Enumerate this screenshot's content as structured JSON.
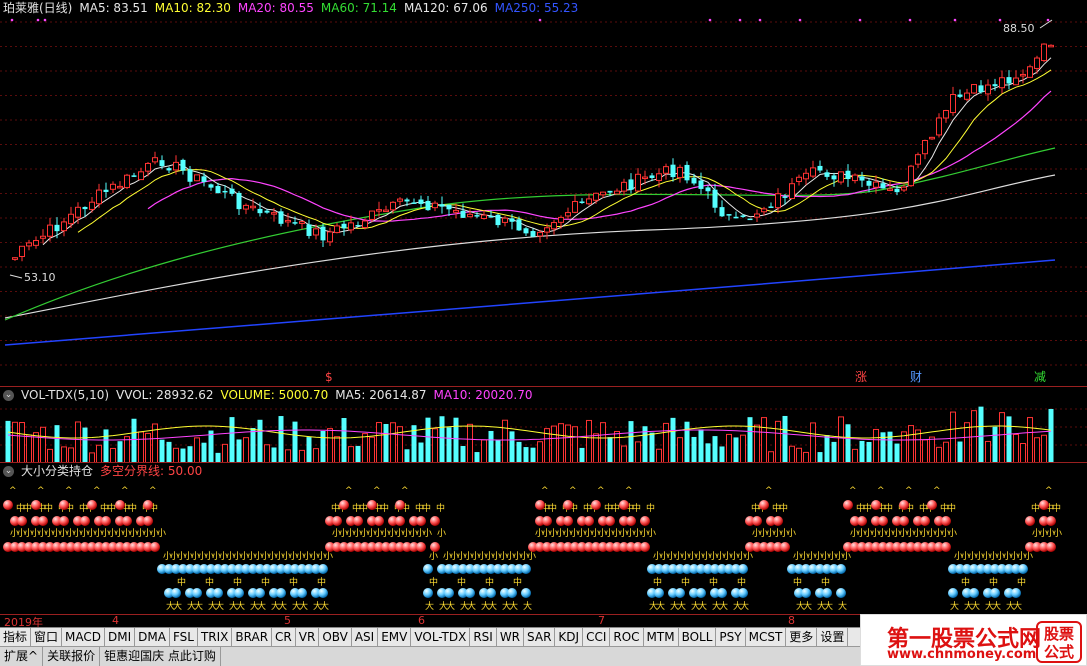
{
  "price_panel": {
    "title": "珀莱雅(日线)",
    "ma": [
      {
        "label": "MA5: 83.51",
        "color": "#e6e6e6"
      },
      {
        "label": "MA10: 82.30",
        "color": "#ffff33"
      },
      {
        "label": "MA20: 80.55",
        "color": "#ff44ff"
      },
      {
        "label": "MA60: 71.14",
        "color": "#33dd33"
      },
      {
        "label": "MA120: 67.06",
        "color": "#e6e6e6"
      },
      {
        "label": "MA250: 55.23",
        "color": "#3355ff"
      }
    ],
    "high_label": "88.50",
    "low_label": "53.10",
    "events": [
      {
        "label": "$",
        "color": "#ff4444"
      },
      {
        "label": "涨",
        "color": "#ff4444"
      },
      {
        "label": "财",
        "color": "#5599ff"
      },
      {
        "label": "减",
        "color": "#33dd33"
      }
    ],
    "colors": {
      "up": "#ff3333",
      "down": "#55ffff",
      "grid": "#6a1010"
    }
  },
  "volume_panel": {
    "title": "VOL-TDX(5,10)",
    "legend": [
      {
        "label": "VVOL: 28932.62",
        "color": "#e6e6e6"
      },
      {
        "label": "VOLUME: 5000.70",
        "color": "#ffff33"
      },
      {
        "label": "MA5: 20614.87",
        "color": "#e6e6e6"
      },
      {
        "label": "MA10: 20020.70",
        "color": "#ff44ff"
      }
    ]
  },
  "classify_panel": {
    "title": "大小分类持仓",
    "legend": [
      {
        "label": "多空分界线: 50.00",
        "color": "#ff4444"
      }
    ],
    "glyphs": {
      "big": "大",
      "mid": "中",
      "small": "小",
      "tick": "^"
    }
  },
  "axis": {
    "year": "2019年",
    "months": [
      "4",
      "5",
      "6",
      "7",
      "8"
    ]
  },
  "tabs": [
    "指标",
    "窗口",
    "MACD",
    "DMI",
    "DMA",
    "FSL",
    "TRIX",
    "BRAR",
    "CR",
    "VR",
    "OBV",
    "ASI",
    "EMV",
    "VOL-TDX",
    "RSI",
    "WR",
    "SAR",
    "KDJ",
    "CCI",
    "ROC",
    "MTM",
    "BOLL",
    "PSY",
    "MCST",
    "更多",
    "设置"
  ],
  "status_buttons": [
    "扩展^",
    "关联报价",
    "钜惠迎国庆 点此订购"
  ],
  "logo": {
    "brand": "第一股票公式网",
    "url": "www.chnmoney.com",
    "stamp_line1": "股票",
    "stamp_line2": "公式"
  }
}
